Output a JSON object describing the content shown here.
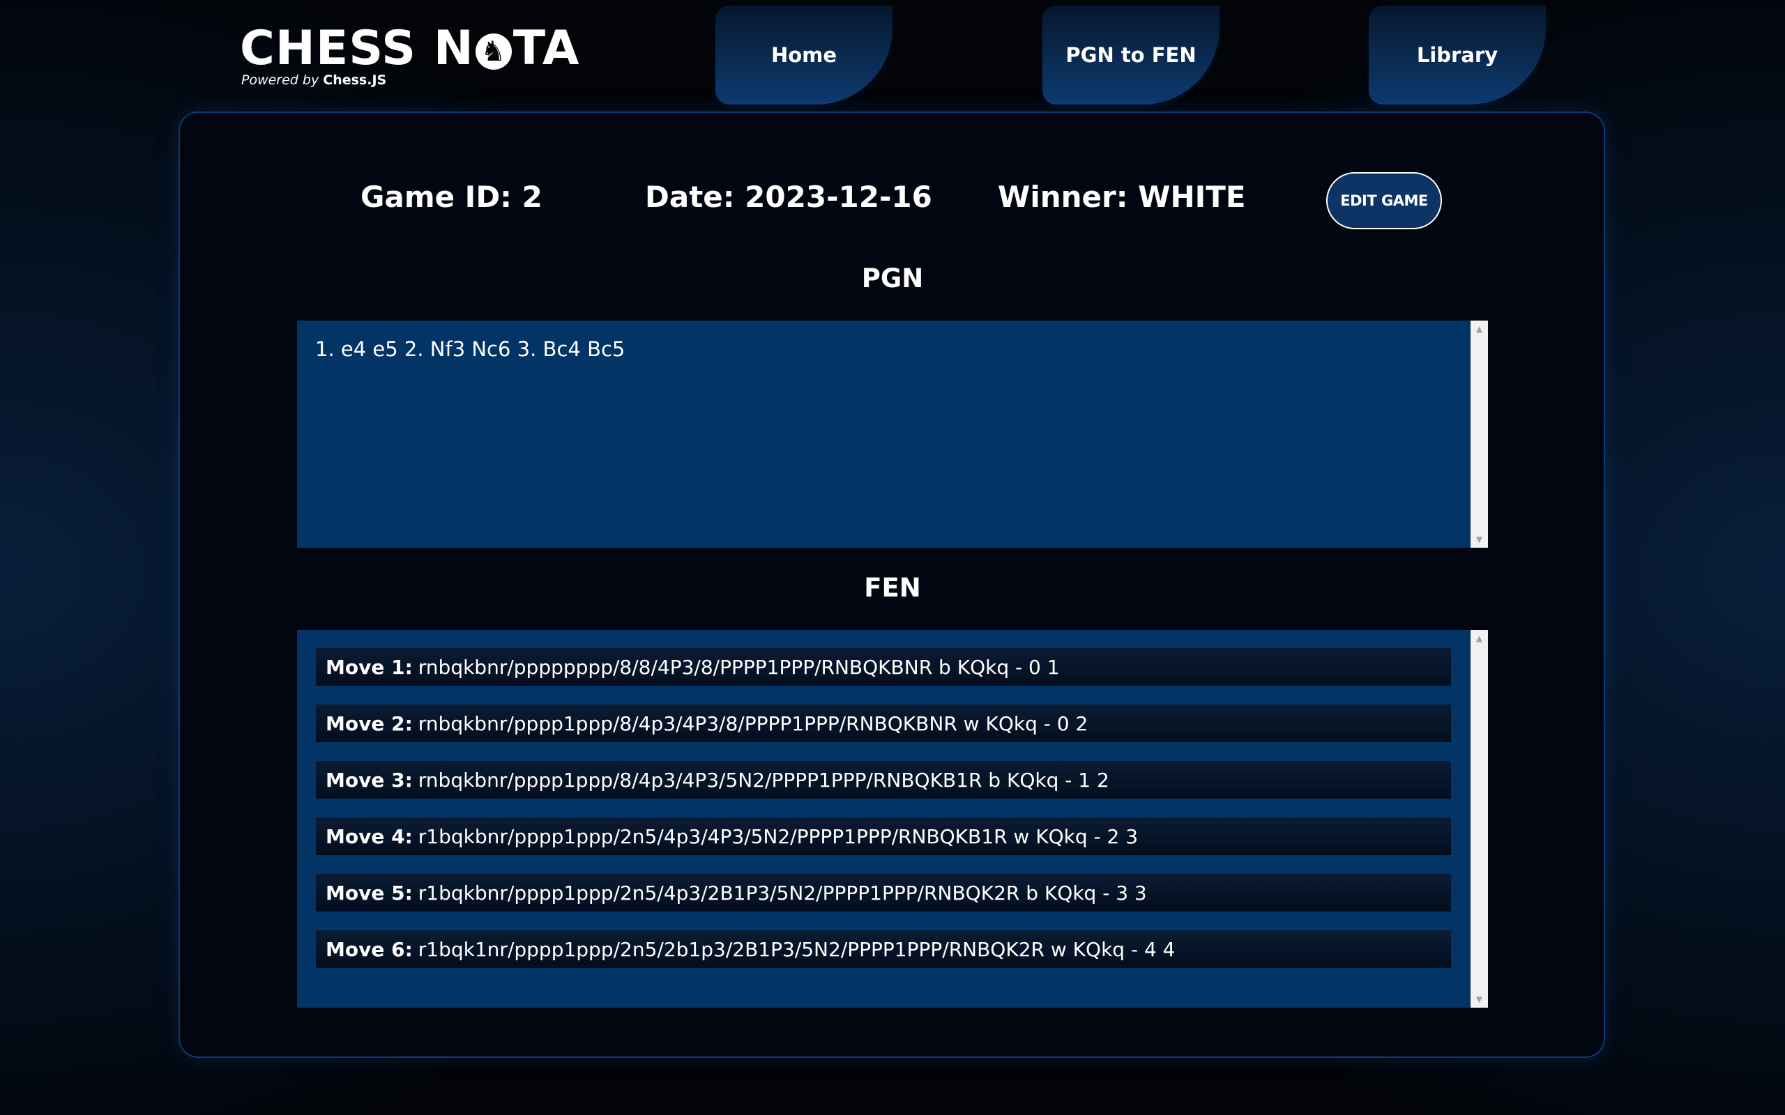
{
  "logo": {
    "title_left": "CHESS N",
    "title_right": "TA",
    "icon_glyph": "♞",
    "powered_prefix": "Powered by",
    "powered_brand": "Chess.JS"
  },
  "nav": {
    "home": "Home",
    "pgn_to_fen": "PGN to FEN",
    "library": "Library"
  },
  "game": {
    "id_text": "Game ID: 2",
    "date_text": "Date: 2023-12-16",
    "winner_text": "Winner: WHITE",
    "edit_label": "EDIT GAME"
  },
  "pgn": {
    "title": "PGN",
    "text": "1. e4 e5 2. Nf3 Nc6 3. Bc4 Bc5"
  },
  "fen": {
    "title": "FEN",
    "moves": [
      {
        "label": "Move 1:",
        "value": "rnbqkbnr/pppppppp/8/8/4P3/8/PPPP1PPP/RNBQKBNR b KQkq - 0 1"
      },
      {
        "label": "Move 2:",
        "value": "rnbqkbnr/pppp1ppp/8/4p3/4P3/8/PPPP1PPP/RNBQKBNR w KQkq - 0 2"
      },
      {
        "label": "Move 3:",
        "value": "rnbqkbnr/pppp1ppp/8/4p3/4P3/5N2/PPPP1PPP/RNBQKB1R b KQkq - 1 2"
      },
      {
        "label": "Move 4:",
        "value": "r1bqkbnr/pppp1ppp/2n5/4p3/4P3/5N2/PPPP1PPP/RNBQKB1R w KQkq - 2 3"
      },
      {
        "label": "Move 5:",
        "value": "r1bqkbnr/pppp1ppp/2n5/4p3/2B1P3/5N2/PPPP1PPP/RNBQK2R b KQkq - 3 3"
      },
      {
        "label": "Move 6:",
        "value": "r1bqk1nr/pppp1ppp/2n5/2b1p3/2B1P3/5N2/PPPP1PPP/RNBQK2R w KQkq - 4 4"
      }
    ]
  },
  "icons": {
    "scroll_up": "▲",
    "scroll_down": "▼"
  },
  "colors": {
    "panel_blue": "#023466",
    "nav_blue": "#0a2b52",
    "background": "#020408"
  }
}
